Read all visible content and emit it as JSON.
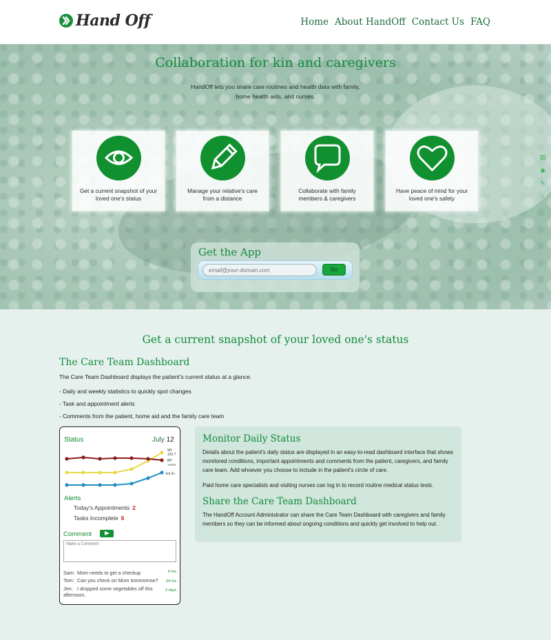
{
  "brand": {
    "name": "Hand Off",
    "accent": "#128b3a",
    "icon": "handoff-logo-icon"
  },
  "nav": [
    "Home",
    "About HandOff",
    "Contact Us",
    "FAQ"
  ],
  "hero": {
    "title": "Collaboration for kin and caregivers",
    "subtitle": "HandOff lets you share care routines and health data with family, home health aids, and nurses.",
    "features": [
      {
        "icon": "eye-icon",
        "text": "Get a current snapshot of your loved one's status"
      },
      {
        "icon": "pencil-icon",
        "text": "Manage your relative's care from a distance"
      },
      {
        "icon": "chat-bubble-icon",
        "text": "Collaborate with family members & caregivers"
      },
      {
        "icon": "heart-icon",
        "text": "Have peace of mind for your loved one's safety"
      }
    ],
    "get_app": {
      "title": "Get the App",
      "placeholder": "email@your-domain.com",
      "button": "Go"
    }
  },
  "side_icons": [
    "briefcase-icon",
    "eye-icon",
    "pencil-icon",
    "chat-bubble-icon",
    "heart-icon"
  ],
  "main": {
    "section_title": "Get a current snapshot of your loved one's status",
    "dashboard_title": "The Care Team Dashboard",
    "dashboard_desc": "The Care Team Dashboard displays the patient's current status at a glance.",
    "bullets": [
      "- Daily and weekly statistics to quickly spot changes",
      "- Task and appointment alerts",
      "- Comments from the patient, home aid and the family care team"
    ]
  },
  "phone": {
    "status_label": "Status",
    "date_month": "July",
    "date_day": "12",
    "series_colors": {
      "wt": "#e8d84a",
      "bp": "#8b1a1a",
      "ed": "#1f8fc0"
    },
    "series_labels": {
      "wt": "Wt",
      "wt_value": "102.7",
      "bp": "BP",
      "bp_value": "145/90",
      "ed": "Ed 3+"
    },
    "alerts_label": "Alerts",
    "appointments_label": "Today's Appointments",
    "appointments_count": "2",
    "tasks_label": "Tasks Incomplete",
    "tasks_count": "6",
    "comment_label": "Comment",
    "comment_placeholder": "Make a Comment",
    "messages": [
      {
        "who": "Sam:",
        "text": "Mom needs to get a checkup",
        "time": "6 hrs"
      },
      {
        "who": "Tom:",
        "text": "Can you check on Mom tommorrow?",
        "time": "24 hrs"
      },
      {
        "who": "Jen:",
        "text": "I dropped some vegetables off this afternoon.",
        "time": "2 days"
      }
    ]
  },
  "panel": {
    "monitor_title": "Monitor Daily Status",
    "monitor_p1": "Details about the patient's daily status are displayed in an easy-to-read dashboard interface that shows monitored conditions, important appointments and comments from the patient, caregivers, and family care team. Add whoever you choose to include in the patient's circle of care.",
    "monitor_p2": "Paid home care specialists and visiting nurses can log in to record routine medical status tests.",
    "share_title": "Share the Care Team Dashboard",
    "share_p": "The HandOff Account Administrator can share the Care Team Dashboard with caregivers and family members so they can be informed about ongoing conditions and quickly get involved to help out."
  }
}
